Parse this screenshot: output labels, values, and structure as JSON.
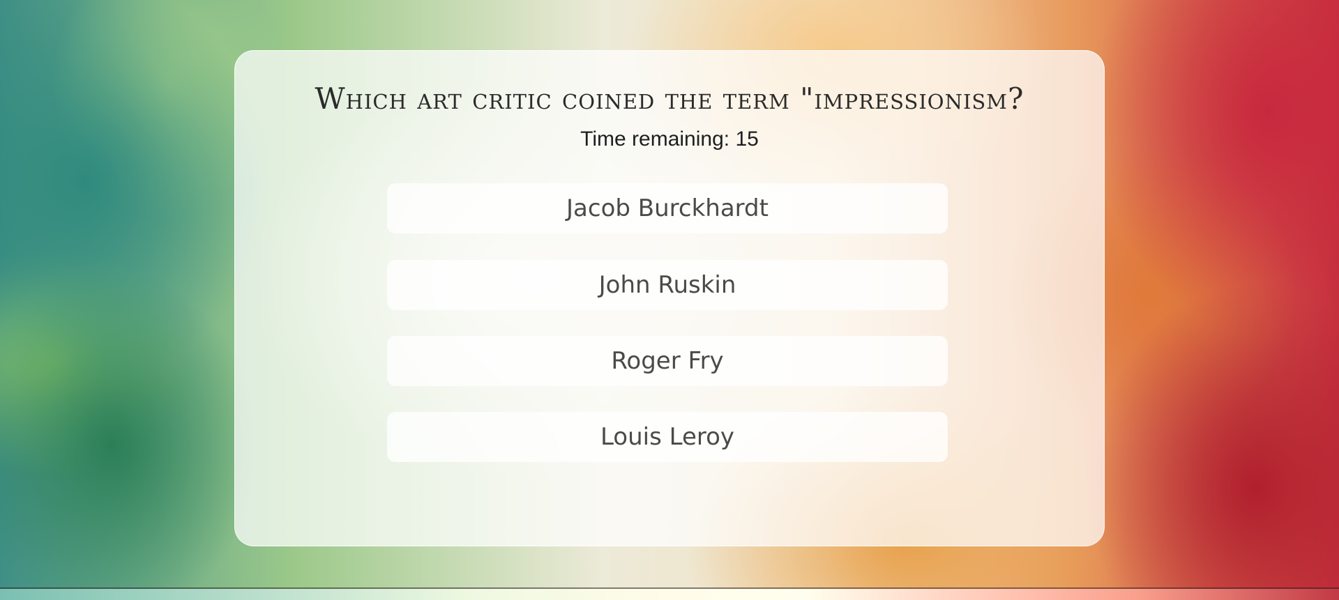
{
  "quiz": {
    "question": "Which art critic coined the term \"impressionism?",
    "timer_label": "Time remaining: 15",
    "answers": [
      {
        "label": "Jacob Burckhardt"
      },
      {
        "label": "John Ruskin"
      },
      {
        "label": "Roger Fry"
      },
      {
        "label": "Louis Leroy"
      }
    ]
  },
  "colors": {
    "card_background": "#ffffff",
    "question_text": "#2b2b2b",
    "answer_text": "#4a4a4a"
  }
}
